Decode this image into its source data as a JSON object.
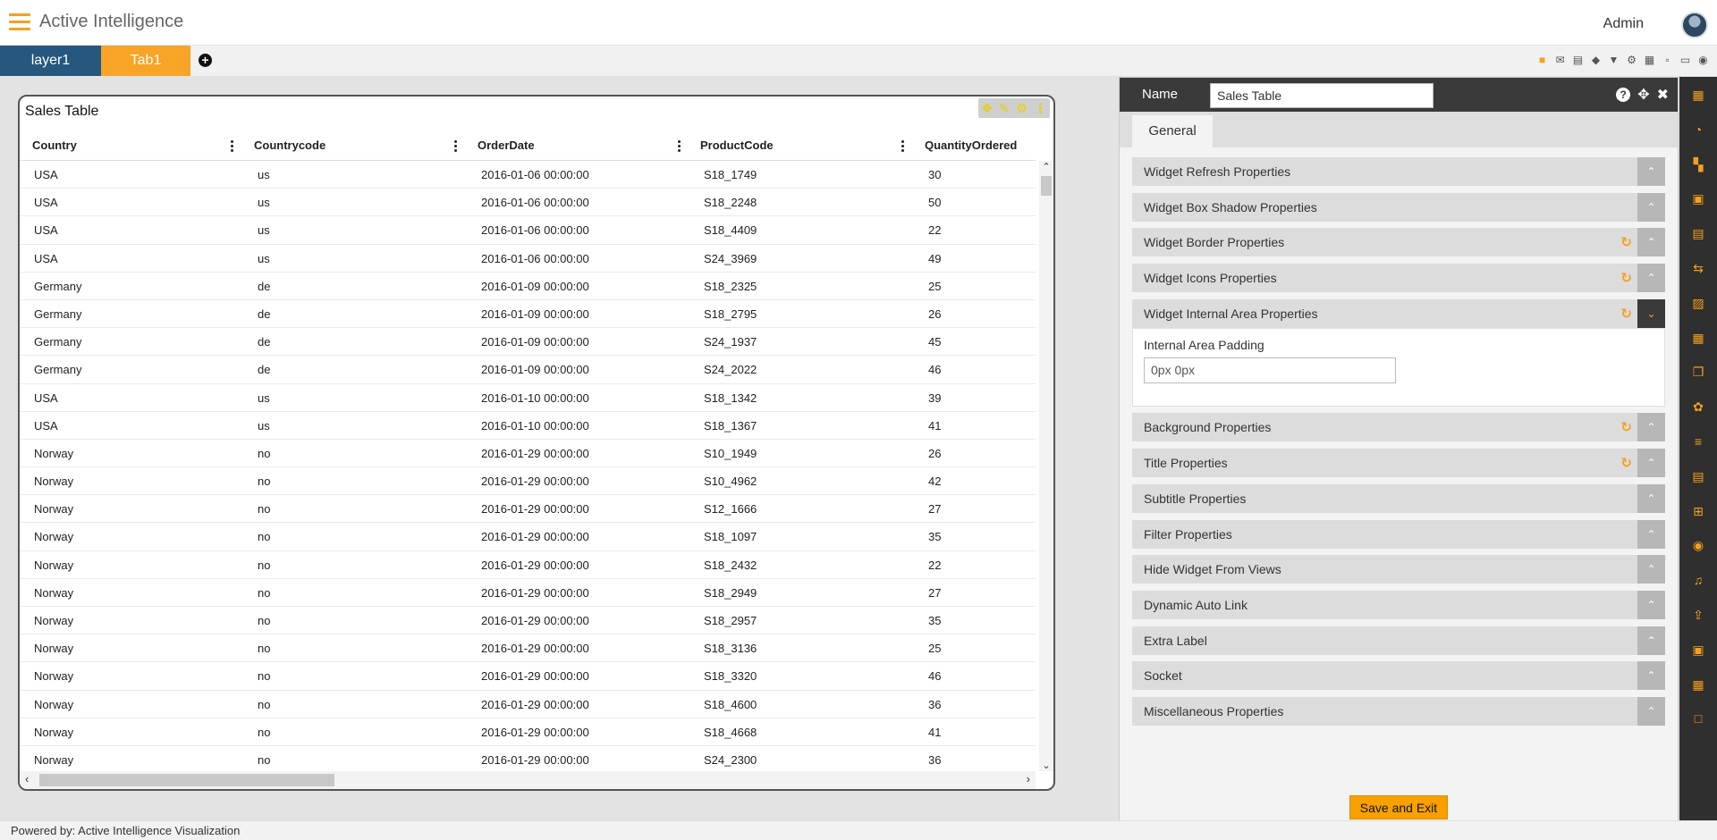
{
  "header": {
    "app_title": "Active Intelligence",
    "user_name": "Admin"
  },
  "tabs": [
    {
      "label": "layer1"
    },
    {
      "label": "Tab1"
    }
  ],
  "toolbar_icons": [
    "save-icon",
    "email-icon",
    "comment-icon",
    "eraser-icon",
    "filter-icon",
    "gear-icon",
    "grid-icon",
    "layout-icon",
    "monitor-icon",
    "eye-icon"
  ],
  "widget": {
    "title": "Sales Table",
    "columns": [
      "Country",
      "Countrycode",
      "OrderDate",
      "ProductCode",
      "QuantityOrdered"
    ],
    "rows": [
      [
        "USA",
        "us",
        "2016-01-06 00:00:00",
        "S18_1749",
        "30"
      ],
      [
        "USA",
        "us",
        "2016-01-06 00:00:00",
        "S18_2248",
        "50"
      ],
      [
        "USA",
        "us",
        "2016-01-06 00:00:00",
        "S18_4409",
        "22"
      ],
      [
        "USA",
        "us",
        "2016-01-06 00:00:00",
        "S24_3969",
        "49"
      ],
      [
        "Germany",
        "de",
        "2016-01-09 00:00:00",
        "S18_2325",
        "25"
      ],
      [
        "Germany",
        "de",
        "2016-01-09 00:00:00",
        "S18_2795",
        "26"
      ],
      [
        "Germany",
        "de",
        "2016-01-09 00:00:00",
        "S24_1937",
        "45"
      ],
      [
        "Germany",
        "de",
        "2016-01-09 00:00:00",
        "S24_2022",
        "46"
      ],
      [
        "USA",
        "us",
        "2016-01-10 00:00:00",
        "S18_1342",
        "39"
      ],
      [
        "USA",
        "us",
        "2016-01-10 00:00:00",
        "S18_1367",
        "41"
      ],
      [
        "Norway",
        "no",
        "2016-01-29 00:00:00",
        "S10_1949",
        "26"
      ],
      [
        "Norway",
        "no",
        "2016-01-29 00:00:00",
        "S10_4962",
        "42"
      ],
      [
        "Norway",
        "no",
        "2016-01-29 00:00:00",
        "S12_1666",
        "27"
      ],
      [
        "Norway",
        "no",
        "2016-01-29 00:00:00",
        "S18_1097",
        "35"
      ],
      [
        "Norway",
        "no",
        "2016-01-29 00:00:00",
        "S18_2432",
        "22"
      ],
      [
        "Norway",
        "no",
        "2016-01-29 00:00:00",
        "S18_2949",
        "27"
      ],
      [
        "Norway",
        "no",
        "2016-01-29 00:00:00",
        "S18_2957",
        "35"
      ],
      [
        "Norway",
        "no",
        "2016-01-29 00:00:00",
        "S18_3136",
        "25"
      ],
      [
        "Norway",
        "no",
        "2016-01-29 00:00:00",
        "S18_3320",
        "46"
      ],
      [
        "Norway",
        "no",
        "2016-01-29 00:00:00",
        "S18_4600",
        "36"
      ],
      [
        "Norway",
        "no",
        "2016-01-29 00:00:00",
        "S18_4668",
        "41"
      ],
      [
        "Norway",
        "no",
        "2016-01-29 00:00:00",
        "S24_2300",
        "36"
      ]
    ]
  },
  "properties": {
    "name_label": "Name",
    "name_value": "Sales Table",
    "tab_label": "General",
    "sections": [
      {
        "label": "Widget Refresh Properties",
        "refresh": false,
        "expanded": false
      },
      {
        "label": "Widget Box Shadow Properties",
        "refresh": false,
        "expanded": false
      },
      {
        "label": "Widget Border Properties",
        "refresh": true,
        "expanded": false
      },
      {
        "label": "Widget Icons Properties",
        "refresh": true,
        "expanded": false
      },
      {
        "label": "Widget Internal Area Properties",
        "refresh": true,
        "expanded": true
      },
      {
        "label": "Background Properties",
        "refresh": true,
        "expanded": false
      },
      {
        "label": "Title Properties",
        "refresh": true,
        "expanded": false
      },
      {
        "label": "Subtitle Properties",
        "refresh": false,
        "expanded": false
      },
      {
        "label": "Filter Properties",
        "refresh": false,
        "expanded": false
      },
      {
        "label": "Hide Widget From Views",
        "refresh": false,
        "expanded": false
      },
      {
        "label": "Dynamic Auto Link",
        "refresh": false,
        "expanded": false
      },
      {
        "label": "Extra Label",
        "refresh": false,
        "expanded": false
      },
      {
        "label": "Socket",
        "refresh": false,
        "expanded": false
      },
      {
        "label": "Miscellaneous Properties",
        "refresh": false,
        "expanded": false
      }
    ],
    "internal_padding_label": "Internal Area Padding",
    "internal_padding_value": "0px 0px",
    "save_label": "Save and Exit"
  },
  "rail_icons": [
    "table-icon",
    "pie-chart-icon",
    "map-icon",
    "clipboard-icon",
    "document-icon",
    "flow-icon",
    "image-icon",
    "grid-table-icon",
    "copy-icon",
    "cubes-icon",
    "list-icon",
    "file-icon",
    "hierarchy-icon",
    "eye-icon",
    "alarm-icon",
    "upload-icon",
    "presentation-icon",
    "apps-icon",
    "square-icon"
  ],
  "colors": {
    "accent": "#f5a01d",
    "layer_tab": "#25577f",
    "active_tab": "#f7a427",
    "panel_dark": "#3a3a3a"
  },
  "footer": {
    "text": "Powered by: Active Intelligence Visualization"
  }
}
